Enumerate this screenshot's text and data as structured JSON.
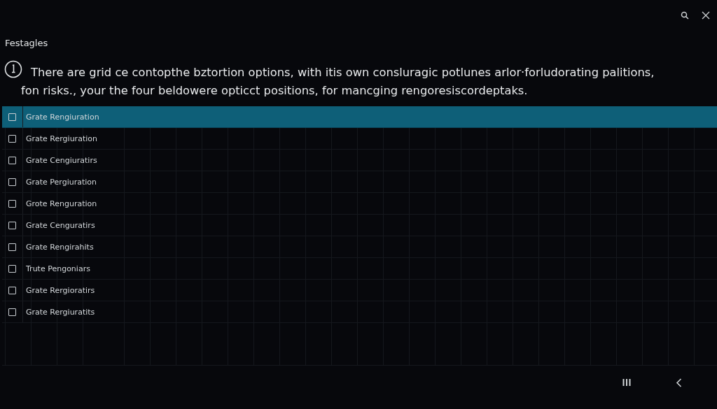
{
  "title": "Festagles",
  "info_lines": [
    "There are grid ce contopthe bztortion options, with itis own consluragic potlunes arlor·forludorating palitions,",
    "fon risks., your the four beldowere opticct positions, for mancging rengoresiscordeptaks."
  ],
  "rows": [
    {
      "label": "Grate Rengiuration",
      "selected": true,
      "checked": false
    },
    {
      "label": "Grate Rergiuration",
      "selected": false,
      "checked": false
    },
    {
      "label": "Grate Cengiuratirs",
      "selected": false,
      "checked": false
    },
    {
      "label": "Grate Pergiuration",
      "selected": false,
      "checked": false
    },
    {
      "label": "Grote Renguration",
      "selected": false,
      "checked": false
    },
    {
      "label": "Grate Cenguratirs",
      "selected": false,
      "checked": false
    },
    {
      "label": "Grate Rengirahits",
      "selected": false,
      "checked": false
    },
    {
      "label": "Trute Pengoniars",
      "selected": false,
      "checked": false
    },
    {
      "label": "Grate Rergioratirs",
      "selected": false,
      "checked": false
    },
    {
      "label": "Grate Rergiuratits",
      "selected": false,
      "checked": false
    }
  ]
}
